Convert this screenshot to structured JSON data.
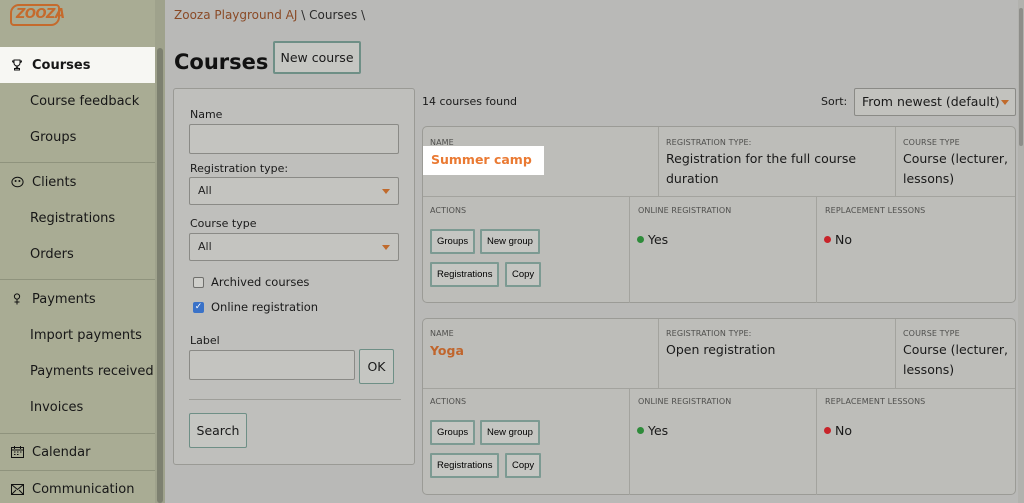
{
  "app": {
    "logo_text": "ZOOZA"
  },
  "sidebar": {
    "items": [
      {
        "label": "Courses",
        "icon": "trophy-icon"
      },
      {
        "label": "Course feedback"
      },
      {
        "label": "Groups"
      },
      {
        "label": "Clients",
        "icon": "clients-icon"
      },
      {
        "label": "Registrations"
      },
      {
        "label": "Orders"
      },
      {
        "label": "Payments",
        "icon": "coins-icon"
      },
      {
        "label": "Import payments"
      },
      {
        "label": "Payments received"
      },
      {
        "label": "Invoices"
      },
      {
        "label": "Calendar",
        "icon": "calendar-icon"
      },
      {
        "label": "Communication",
        "icon": "envelope-icon"
      }
    ]
  },
  "breadcrumb": {
    "org": "Zooza Playground AJ",
    "sep": "\\",
    "page": "Courses",
    "sep2": "\\"
  },
  "page": {
    "title": "Courses",
    "new_course": "New course"
  },
  "filters": {
    "name_label": "Name",
    "reg_type_label": "Registration type:",
    "reg_type_value": "All",
    "course_type_label": "Course type",
    "course_type_value": "All",
    "archived_label": "Archived courses",
    "online_label": "Online registration",
    "label_label": "Label",
    "ok": "OK",
    "search": "Search"
  },
  "results": {
    "count": "14 courses found",
    "sort_label": "Sort:",
    "sort_value": "From newest (default)"
  },
  "columns": {
    "name": "NAME",
    "reg_type": "REGISTRATION TYPE:",
    "course_type": "COURSE TYPE",
    "actions": "ACTIONS",
    "online": "ONLINE REGISTRATION",
    "replacement": "REPLACEMENT LESSONS"
  },
  "action_buttons": {
    "groups": "Groups",
    "new_group": "New group",
    "registrations": "Registrations",
    "copy": "Copy"
  },
  "courses": [
    {
      "name": "Summer camp",
      "reg_type_l1": "Registration for the full course",
      "reg_type_l2": "duration",
      "course_type_l1": "Course (lecturer,",
      "course_type_l2": "lessons)",
      "online": "Yes",
      "replacement": "No"
    },
    {
      "name": "Yoga",
      "reg_type_l1": "Open registration",
      "reg_type_l2": "",
      "course_type_l1": "Course (lecturer,",
      "course_type_l2": "lessons)",
      "online": "Yes",
      "replacement": "No"
    }
  ],
  "colors": {
    "accent": "#ea7a33",
    "yes_dot": "#2e8b3a",
    "no_dot": "#c8242a",
    "check": "#3a72c8"
  }
}
